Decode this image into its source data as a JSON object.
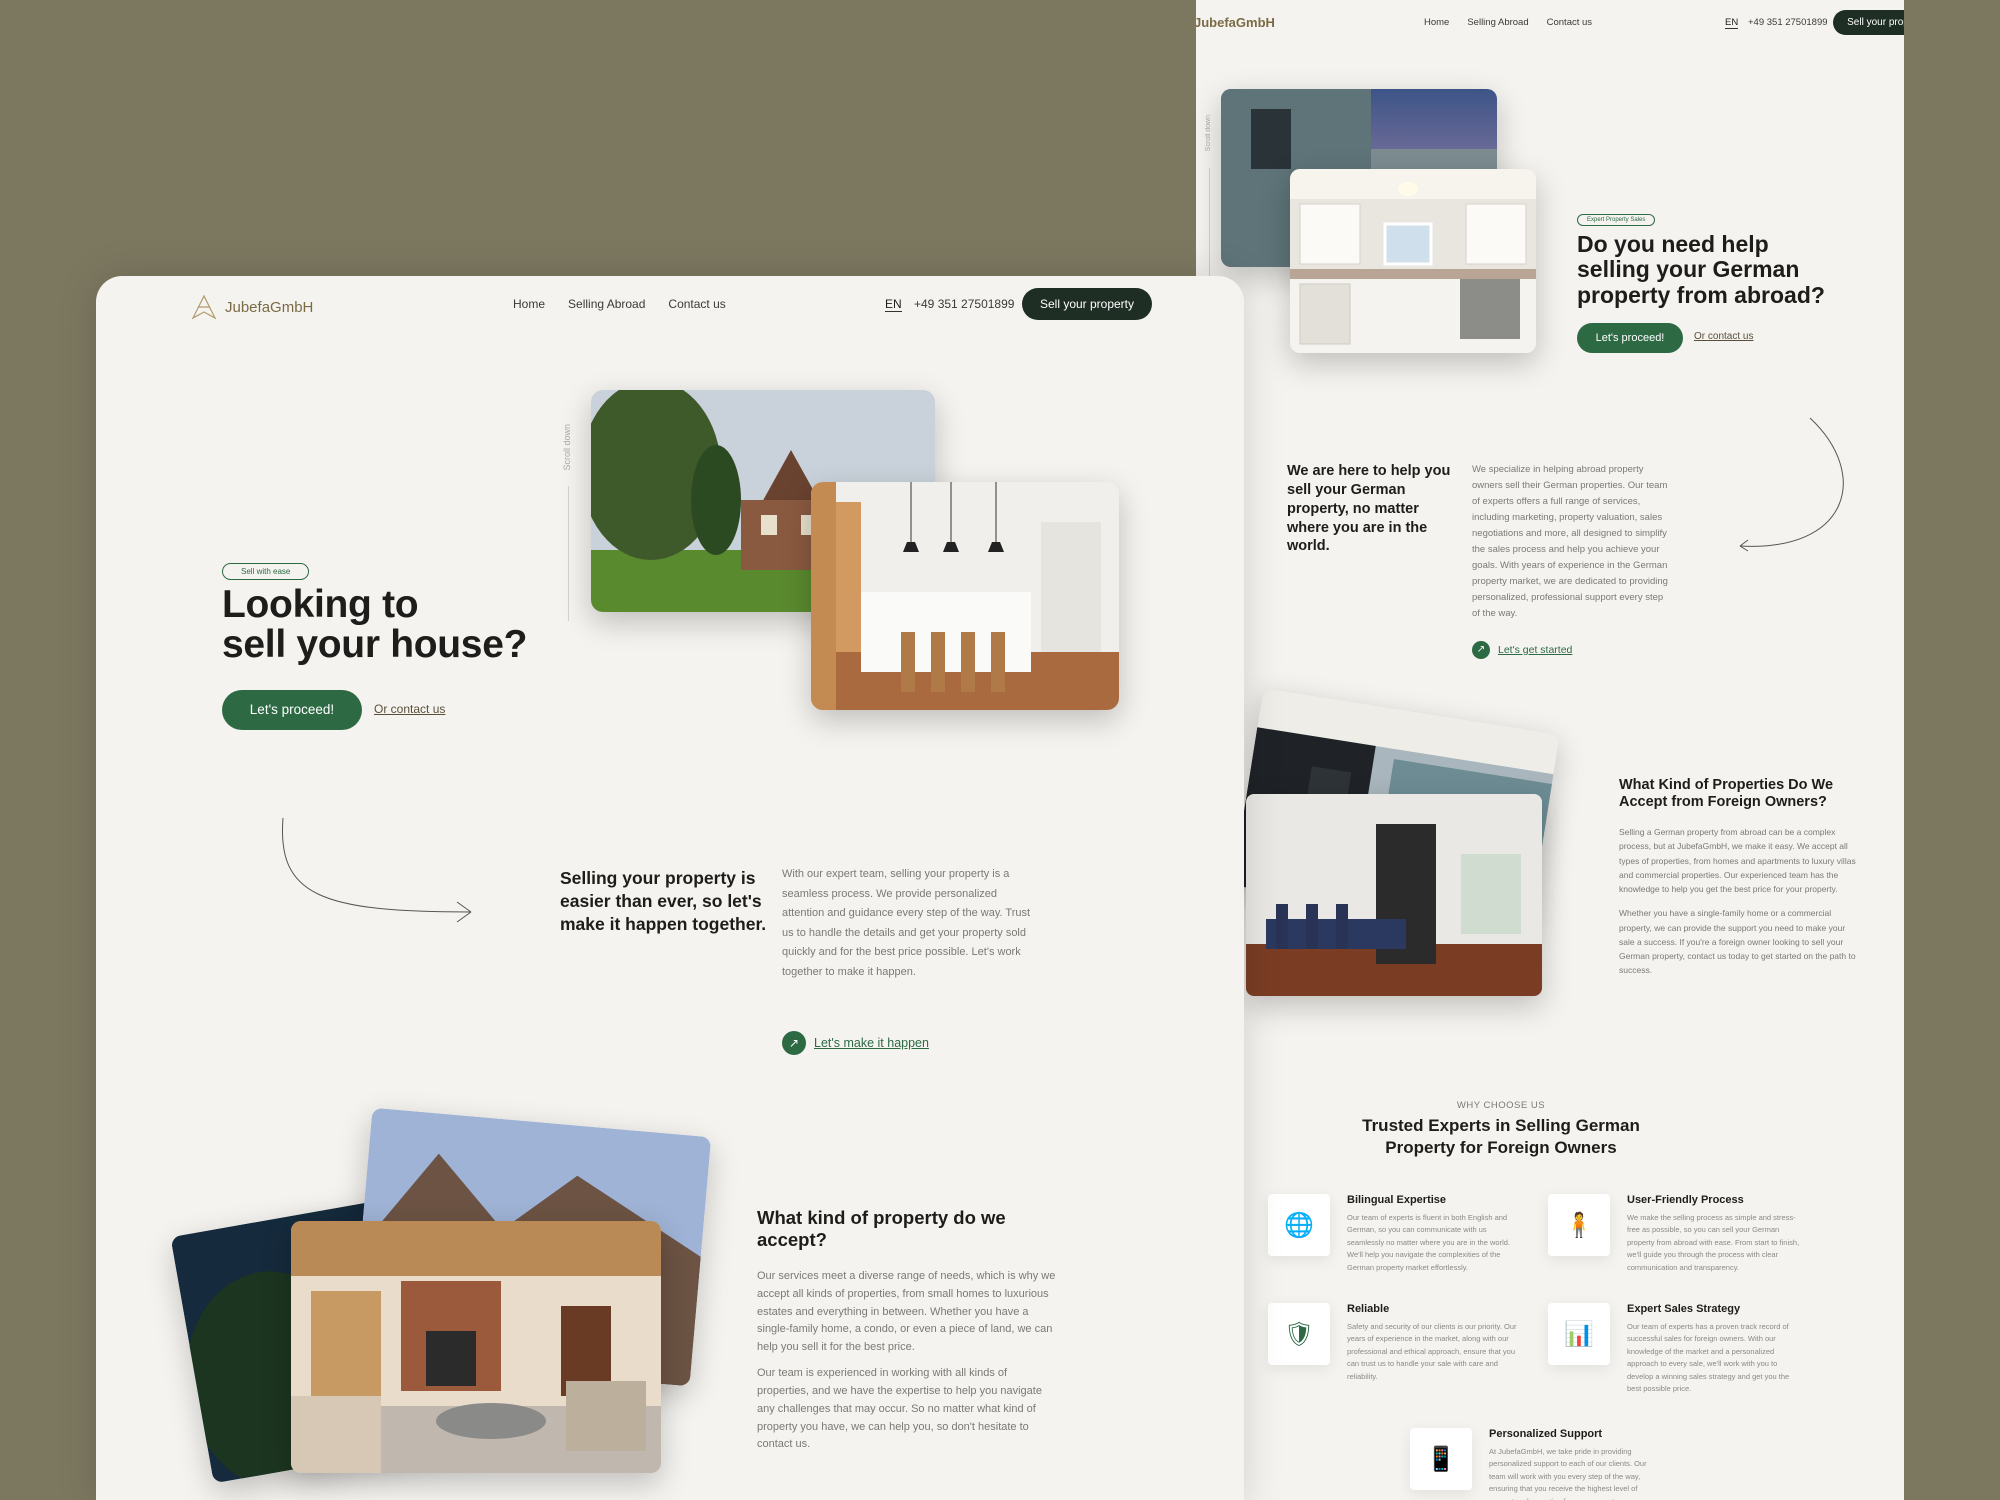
{
  "brand": {
    "name": "JubefaGmbH",
    "accent": "#2d6a44",
    "dark": "#1f2e25",
    "background": "#7c7860",
    "page": "#f5f3ef"
  },
  "nav": {
    "items": [
      "Home",
      "Selling Abroad",
      "Contact us"
    ],
    "lang": "EN",
    "phone": "+49 351 27501899",
    "cta": "Sell your property"
  },
  "back_page": {
    "logo_text": "JubefaGmbH",
    "cta_clipped": "Sell your prop",
    "scroll": "Scroll down",
    "hero": {
      "tag": "Expert Property Sales",
      "title": "Do you need help selling your German property from abroad?",
      "proceed": "Let's proceed!",
      "contact": "Or contact us"
    },
    "help": {
      "title": "We are here to help you sell your German property, no matter where you are in the world.",
      "text": "We specialize in helping abroad property owners sell their German properties. Our team of experts offers a full range of services, including marketing, property valuation, sales negotiations and more, all designed to simplify the sales process and help you achieve your goals. With years of experience in the German property market, we are dedicated to providing personalized, professional support every step of the way.",
      "cta": "Let's get started"
    },
    "kinds": {
      "title": "What Kind of Properties Do We Accept from Foreign Owners?",
      "p1": "Selling a German property from abroad can be a complex process, but at JubefaGmbH, we make it easy. We accept all types of properties, from homes and apartments to luxury villas and commercial properties. Our experienced team has the knowledge to help you get the best price for your property.",
      "p2": "Whether you have a single-family home or a commercial property, we can provide the support you need to make your sale a success. If you're a foreign owner looking to sell your German property, contact us today to get started on the path to success."
    },
    "why": {
      "eyebrow": "WHY CHOOSE US",
      "title": "Trusted Experts in Selling German Property for Foreign Owners",
      "features": [
        {
          "title": "Bilingual Expertise",
          "icon": "globe-person-icon",
          "text": "Our team of experts is fluent in both English and German, so you can communicate with us seamlessly no matter where you are in the world. We'll help you navigate the complexities of the German property market effortlessly."
        },
        {
          "title": "User-Friendly Process",
          "icon": "person-flow-icon",
          "text": "We make the selling process as simple and stress-free as possible, so you can sell your German property from abroad with ease. From start to finish, we'll guide you through the process with clear communication and transparency."
        },
        {
          "title": "Reliable",
          "icon": "shield-check-icon",
          "text": "Safety and security of our clients is our priority. Our years of experience in the market, along with our professional and ethical approach, ensure that you can trust us to handle your sale with care and reliability."
        },
        {
          "title": "Expert Sales Strategy",
          "icon": "chart-board-icon",
          "text": "Our team of experts has a proven track record of successful sales for foreign owners. With our knowledge of the market and a personalized approach to every sale, we'll work with you to develop a winning sales strategy and get you the best possible price."
        },
        {
          "title": "Personalized Support",
          "icon": "phone-support-icon",
          "text": "At JubefaGmbH, we take pride in providing personalized support to each of our clients. Our team will work with you every step of the way, ensuring that you receive the highest level of support and expertise for your property"
        }
      ]
    }
  },
  "front_page": {
    "hero": {
      "tag": "Sell with ease",
      "title_line1": "Looking to",
      "title_line2": "sell your house?",
      "proceed": "Let's proceed!",
      "contact": "Or contact us",
      "scroll": "Scroll down"
    },
    "easier": {
      "title": "Selling your property is easier than ever, so let's make it happen together.",
      "text": "With our expert team, selling your property is a seamless process. We provide personalized attention and guidance every step of the way. Trust us to handle the details and get your property sold quickly and for the best price possible. Let's work together to make it happen.",
      "cta": "Let's make it happen"
    },
    "kinds": {
      "title": "What kind of property do we accept?",
      "p1": "Our services meet a diverse range of needs, which is why we accept all kinds of properties, from small homes to luxurious estates and everything in between. Whether you have a single-family home, a condo, or even a piece of land, we can help you sell it for the best price.",
      "p2": "Our team is experienced in working with all kinds of properties, and we have the expertise to help you navigate any challenges that may occur. So no matter what kind of property you have, we can help you, so don't hesitate to contact us."
    }
  }
}
